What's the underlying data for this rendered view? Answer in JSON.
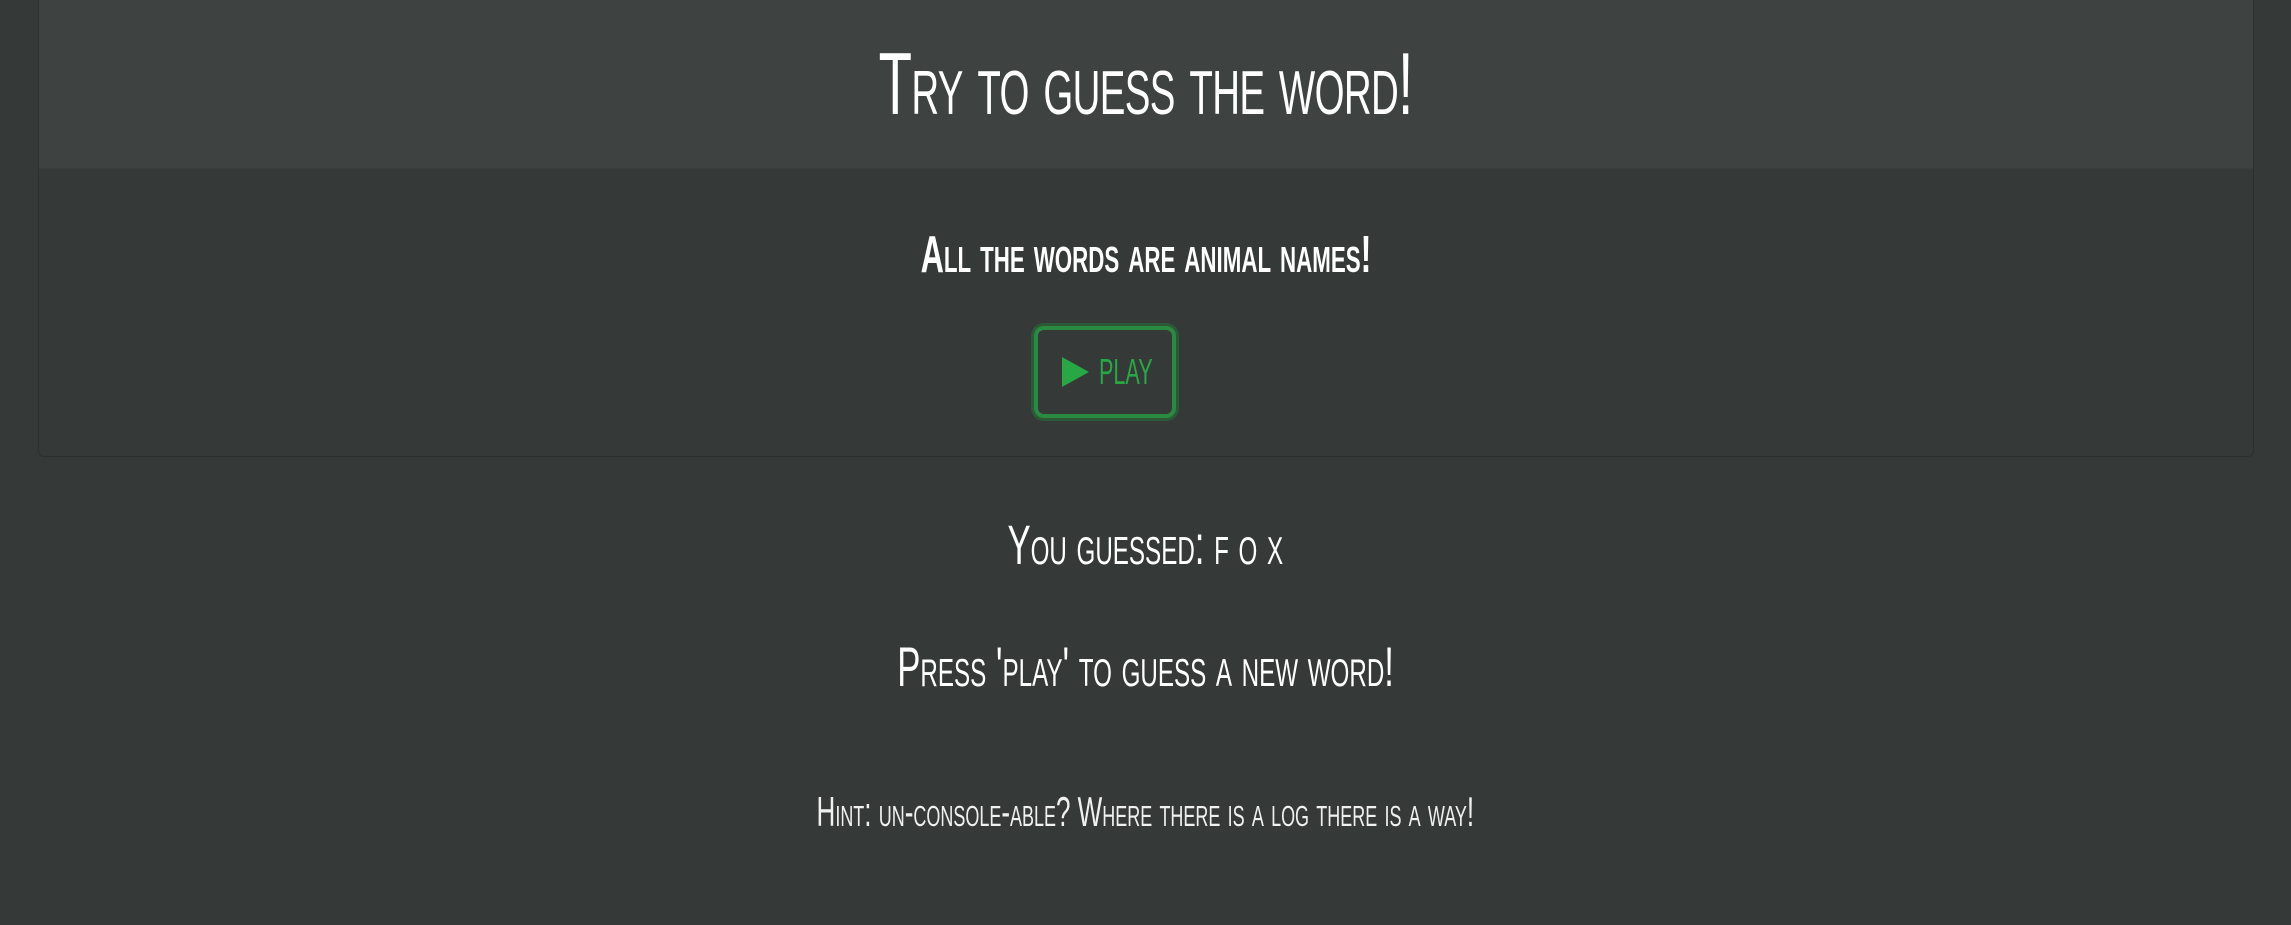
{
  "header": {
    "title": "Try to guess the word!"
  },
  "body": {
    "subtitle": "All the words are animal names!",
    "play_button": {
      "icon": "play-icon",
      "label": "PLAY"
    }
  },
  "status": {
    "guessed": "You guessed: f o x",
    "prompt": "Press 'play' to guess a new word!"
  },
  "hint": "Hint: un-console-able? Where there is a log there is a way!",
  "colors": {
    "background": "#353938",
    "header_background": "#3e4241",
    "accent_green": "#28a745",
    "text": "#ffffff"
  }
}
